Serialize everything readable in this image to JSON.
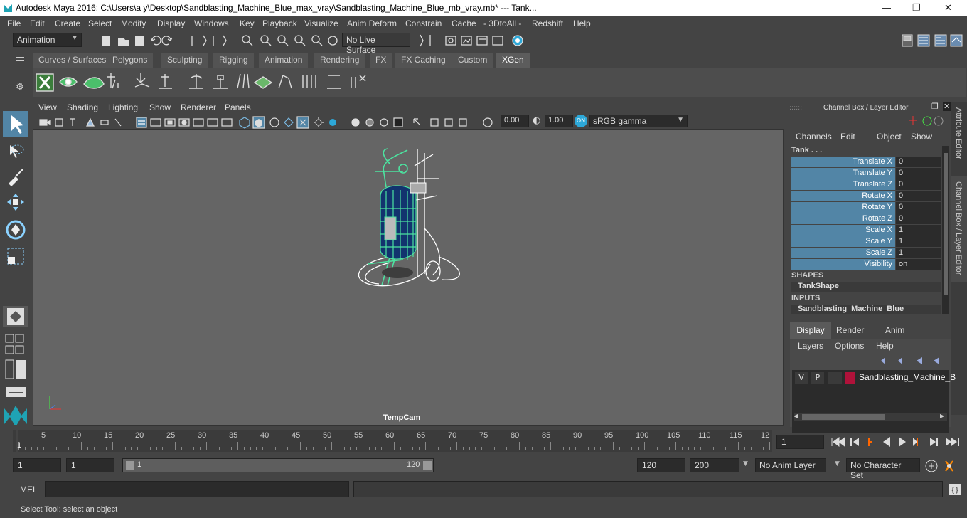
{
  "window": {
    "title": "Autodesk Maya 2016: C:\\Users\\a y\\Desktop\\Sandblasting_Machine_Blue_max_vray\\Sandblasting_Machine_Blue_mb_vray.mb*   ---   Tank..."
  },
  "menubar": {
    "items": [
      "File",
      "Edit",
      "Create",
      "Select",
      "Modify",
      "Display",
      "Windows",
      "Key",
      "Playback",
      "Visualize",
      "Anim Deform",
      "Constrain",
      "Cache",
      "- 3DtoAll -",
      "Redshift",
      "Help"
    ]
  },
  "statusline": {
    "mode": "Animation",
    "live_surface": "No Live Surface"
  },
  "shelf": {
    "tabs": [
      "Curves / Surfaces",
      "Polygons",
      "Sculpting",
      "Rigging",
      "Animation",
      "Rendering",
      "FX",
      "FX Caching",
      "Custom",
      "XGen"
    ],
    "active": "XGen"
  },
  "viewport": {
    "menu": [
      "View",
      "Shading",
      "Lighting",
      "Show",
      "Renderer",
      "Panels"
    ],
    "exposure": "0.00",
    "gamma": "1.00",
    "colorspace": "sRGB gamma",
    "camera_label": "TempCam"
  },
  "channelbox": {
    "title": "Channel Box / Layer Editor",
    "menu": [
      "Channels",
      "Edit",
      "Object",
      "Show"
    ],
    "object": "Tank . . .",
    "channels": [
      {
        "name": "Translate X",
        "value": "0"
      },
      {
        "name": "Translate Y",
        "value": "0"
      },
      {
        "name": "Translate Z",
        "value": "0"
      },
      {
        "name": "Rotate X",
        "value": "0"
      },
      {
        "name": "Rotate Y",
        "value": "0"
      },
      {
        "name": "Rotate Z",
        "value": "0"
      },
      {
        "name": "Scale X",
        "value": "1"
      },
      {
        "name": "Scale Y",
        "value": "1"
      },
      {
        "name": "Scale Z",
        "value": "1"
      },
      {
        "name": "Visibility",
        "value": "on"
      }
    ],
    "shapes_header": "SHAPES",
    "shape": "TankShape",
    "inputs_header": "INPUTS",
    "input": "Sandblasting_Machine_Blue"
  },
  "sidetabs": {
    "attribute_editor": "Attribute Editor",
    "channel_box": "Channel Box / Layer Editor"
  },
  "layers": {
    "tabs": [
      "Display",
      "Render",
      "Anim"
    ],
    "active": "Display",
    "menu": [
      "Layers",
      "Options",
      "Help"
    ],
    "v": "V",
    "p": "P",
    "layer_name": "Sandblasting_Machine_B",
    "layer_color": "#b0123a"
  },
  "timeline": {
    "ticks": [
      "5",
      "10",
      "15",
      "20",
      "25",
      "30",
      "35",
      "40",
      "45",
      "50",
      "55",
      "60",
      "65",
      "70",
      "75",
      "80",
      "85",
      "90",
      "95",
      "100",
      "105",
      "110",
      "115",
      "12"
    ],
    "current_frame_marker": "1",
    "current_frame": "1"
  },
  "range": {
    "start": "1",
    "playback_start": "1",
    "slider_start": "1",
    "slider_end": "120",
    "playback_end": "120",
    "end": "200",
    "anim_layer": "No Anim Layer",
    "character_set": "No Character Set"
  },
  "mel": {
    "label": "MEL"
  },
  "help": {
    "text": "Select Tool: select an object"
  },
  "colors": {
    "accent": "#5285a6",
    "xgen_green": "#4ce3a0",
    "tank_blue": "#12336e"
  }
}
